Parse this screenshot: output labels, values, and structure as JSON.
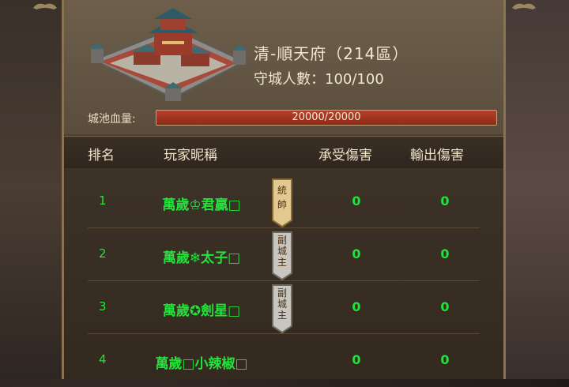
{
  "city": {
    "name": "清-順天府（214區）",
    "defenders_label": "守城人數：100/100"
  },
  "hp": {
    "label": "城池血量:",
    "text": "20000/20000",
    "fraction": 1.0
  },
  "table": {
    "headers": [
      "排名",
      "玩家昵稱",
      "承受傷害",
      "輸出傷害"
    ],
    "rows": [
      {
        "rank": "1",
        "name": "萬歲♔君贏□",
        "badge": "統帥",
        "dmg_in": "0",
        "dmg_out": "0"
      },
      {
        "rank": "2",
        "name": "萬歲❄太子□",
        "badge": "副城主",
        "dmg_in": "0",
        "dmg_out": "0"
      },
      {
        "rank": "3",
        "name": "萬歲✪劍星□",
        "badge": "副城主",
        "dmg_in": "0",
        "dmg_out": "0"
      },
      {
        "rank": "4",
        "name": "萬歲□小辣椒□",
        "badge": "",
        "dmg_in": "0",
        "dmg_out": "0"
      }
    ]
  },
  "colors": {
    "name_green": "#22e33b",
    "hp_red": "#b3412b",
    "panel_gold": "#8a7350"
  },
  "icons": [
    "castle-image",
    "commander-badge-icon",
    "vice-lord-badge-icon",
    "corner-ornament-icon"
  ]
}
